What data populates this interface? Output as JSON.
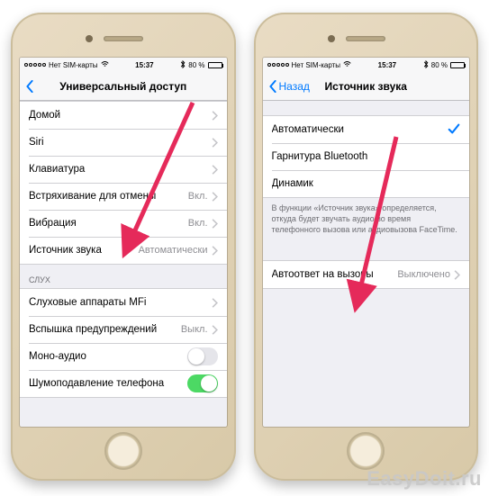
{
  "status": {
    "carrier": "Нет SIM-карты",
    "wifi": "wifi-icon",
    "time": "15:37",
    "bt": "bt-icon",
    "battery_pct": "80 %"
  },
  "phone1": {
    "nav": {
      "back": "",
      "title": "Универсальный доступ"
    },
    "rows1": [
      {
        "label": "Домой",
        "value": "",
        "kind": "chev"
      },
      {
        "label": "Siri",
        "value": "",
        "kind": "chev"
      },
      {
        "label": "Клавиатура",
        "value": "",
        "kind": "chev"
      },
      {
        "label": "Встряхивание для отмены",
        "value": "Вкл.",
        "kind": "chev"
      },
      {
        "label": "Вибрация",
        "value": "Вкл.",
        "kind": "chev"
      },
      {
        "label": "Источник звука",
        "value": "Автоматически",
        "kind": "chev"
      }
    ],
    "section_label": "СЛУХ",
    "rows2": [
      {
        "label": "Слуховые аппараты MFi",
        "value": "",
        "kind": "chev"
      },
      {
        "label": "Вспышка предупреждений",
        "value": "Выкл.",
        "kind": "chev"
      },
      {
        "label": "Моно-аудио",
        "value": "",
        "kind": "switch",
        "on": false
      },
      {
        "label": "Шумоподавление телефона",
        "value": "",
        "kind": "switch",
        "on": true
      }
    ]
  },
  "phone2": {
    "nav": {
      "back": "Назад",
      "title": "Источник звука"
    },
    "options": [
      {
        "label": "Автоматически",
        "checked": true
      },
      {
        "label": "Гарнитура Bluetooth",
        "checked": false
      },
      {
        "label": "Динамик",
        "checked": false
      }
    ],
    "footer": "В функции «Источник звука» определяется, откуда будет звучать аудио во время телефонного вызова или аудиовызова FaceTime.",
    "rows2": [
      {
        "label": "Автоответ на вызовы",
        "value": "Выключено",
        "kind": "chev"
      }
    ]
  },
  "watermark": "EasyDoit.ru"
}
